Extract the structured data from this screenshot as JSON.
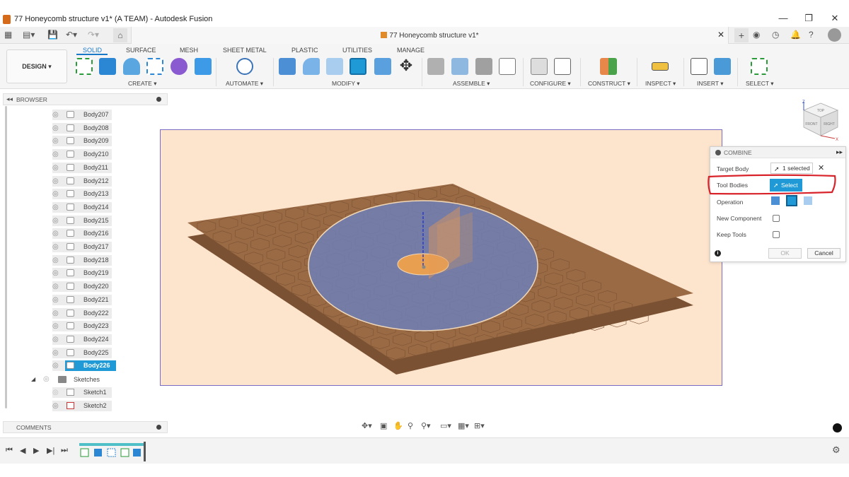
{
  "window": {
    "title": "77 Honeycomb structure v1* (A TEAM) - Autodesk Fusion",
    "controls": [
      "—",
      "❐",
      "✕"
    ]
  },
  "document_tab": {
    "title": "77 Honeycomb structure v1*"
  },
  "workspace": {
    "label": "DESIGN ▾"
  },
  "ribbon": {
    "tabs": [
      "SOLID",
      "SURFACE",
      "MESH",
      "SHEET METAL",
      "PLASTIC",
      "UTILITIES",
      "MANAGE"
    ],
    "active_tab": "SOLID",
    "groups": [
      "CREATE ▾",
      "AUTOMATE ▾",
      "MODIFY ▾",
      "ASSEMBLE ▾",
      "CONFIGURE ▾",
      "CONSTRUCT ▾",
      "INSPECT ▾",
      "INSERT ▾",
      "SELECT ▾"
    ]
  },
  "browser": {
    "title": "BROWSER",
    "bodies": [
      "Body207",
      "Body208",
      "Body209",
      "Body210",
      "Body211",
      "Body212",
      "Body213",
      "Body214",
      "Body215",
      "Body216",
      "Body217",
      "Body218",
      "Body219",
      "Body220",
      "Body221",
      "Body222",
      "Body223",
      "Body224",
      "Body225",
      "Body226"
    ],
    "selected_body": "Body226",
    "sketches_folder": "Sketches",
    "sketches": [
      "Sketch1",
      "Sketch2"
    ]
  },
  "comments": {
    "title": "COMMENTS"
  },
  "combine_panel": {
    "title": "COMBINE",
    "target_body_label": "Target Body",
    "target_body_value": "1 selected",
    "tool_bodies_label": "Tool Bodies",
    "tool_bodies_button": "Select",
    "operation_label": "Operation",
    "new_component_label": "New Component",
    "keep_tools_label": "Keep Tools",
    "new_component_checked": false,
    "keep_tools_checked": false,
    "ok_label": "OK",
    "cancel_label": "Cancel"
  },
  "viewcube": {
    "faces": [
      "TOP",
      "FRONT",
      "RIGHT"
    ],
    "axes": [
      "Z",
      "X"
    ]
  },
  "colors": {
    "accent": "#1f9ad6",
    "viewport_bg": "#fde4cd",
    "honeycomb": "#9a6a44",
    "disc": "#6e7fb6",
    "annotation": "#d8232a"
  }
}
